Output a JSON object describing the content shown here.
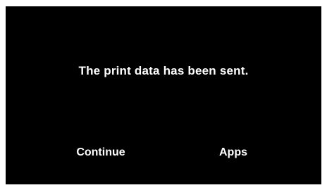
{
  "dialog": {
    "message": "The print data has been sent."
  },
  "actions": {
    "continue_label": "Continue",
    "apps_label": "Apps"
  },
  "colors": {
    "background": "#000000",
    "text": "#ffffff",
    "frame": "#ffffff"
  }
}
